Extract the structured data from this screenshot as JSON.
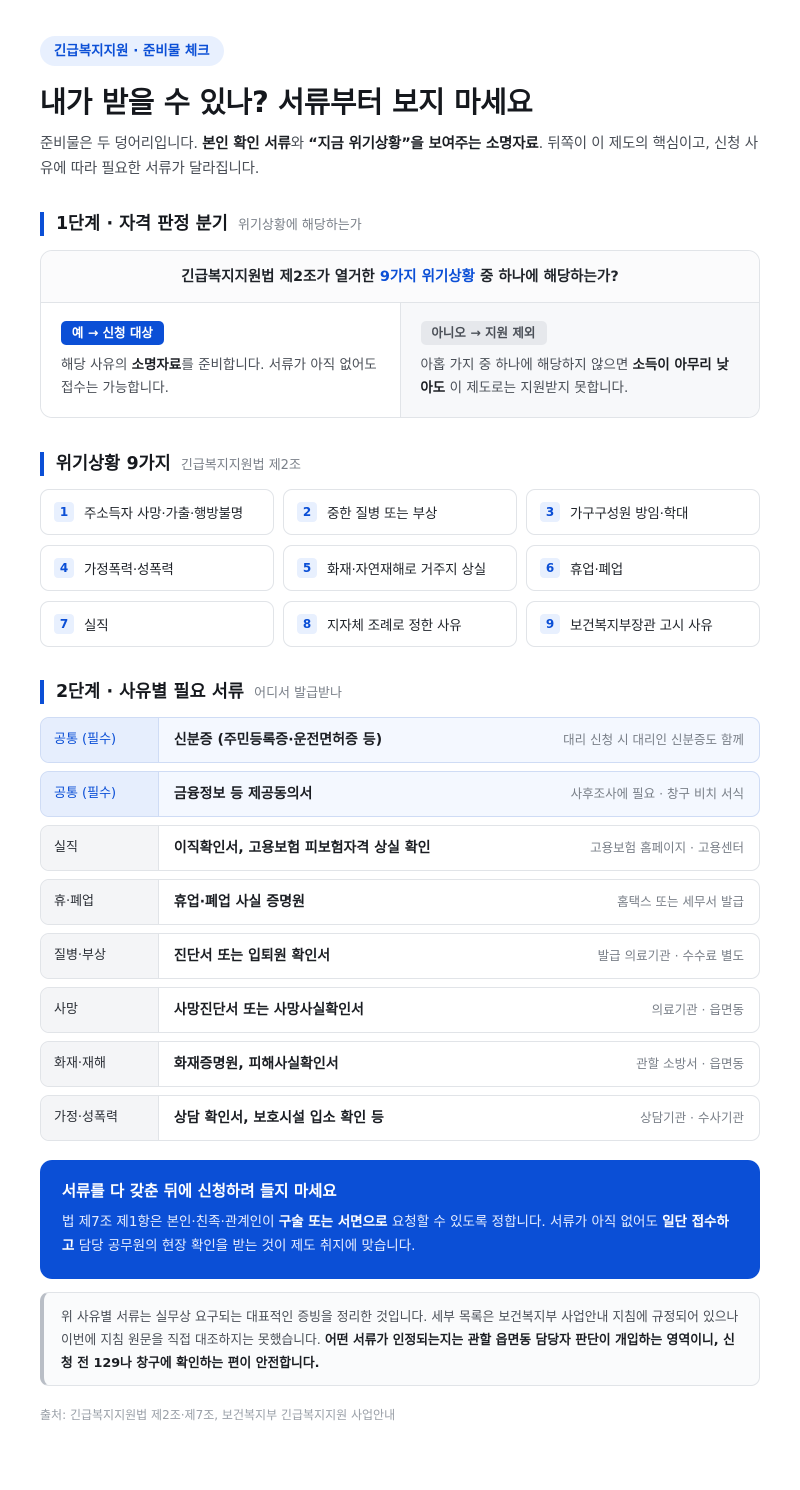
{
  "pill": "긴급복지지원 · 준비물 체크",
  "title": "내가 받을 수 있나? 서류부터 보지 마세요",
  "intro": {
    "p1": "준비물은 두 덩어리입니다. ",
    "b1": "본인 확인 서류",
    "p2": "와 ",
    "b2": "“지금 위기상황”을 보여주는 소명자료",
    "p3": ". 뒤쪽이 이 제도의 핵심이고, 신청 사유에 따라 필요한 서류가 달라집니다."
  },
  "step1": {
    "heading": "1단계 · 자격 판정 분기",
    "sub": "위기상황에 해당하는가",
    "question_pre": "긴급복지지원법 제2조가 열거한 ",
    "question_hl": "9가지 위기상황",
    "question_post": " 중 하나에 해당하는가?",
    "yes_badge": "예 → 신청 대상",
    "yes_p1": "해당 사유의 ",
    "yes_b": "소명자료",
    "yes_p2": "를 준비합니다. 서류가 아직 없어도 접수는 가능합니다.",
    "no_badge": "아니오 → 지원 제외",
    "no_p1": "아홉 가지 중 하나에 해당하지 않으면 ",
    "no_b": "소득이 아무리 낮아도",
    "no_p2": " 이 제도로는 지원받지 못합니다."
  },
  "situations": {
    "heading": "위기상황 9가지",
    "sub": "긴급복지지원법 제2조",
    "items": [
      {
        "n": "1",
        "label": "주소득자 사망·가출·행방불명"
      },
      {
        "n": "2",
        "label": "중한 질병 또는 부상"
      },
      {
        "n": "3",
        "label": "가구구성원 방임·학대"
      },
      {
        "n": "4",
        "label": "가정폭력·성폭력"
      },
      {
        "n": "5",
        "label": "화재·자연재해로 거주지 상실"
      },
      {
        "n": "6",
        "label": "휴업·폐업"
      },
      {
        "n": "7",
        "label": "실직"
      },
      {
        "n": "8",
        "label": "지자체 조례로 정한 사유"
      },
      {
        "n": "9",
        "label": "보건복지부장관 고시 사유"
      }
    ]
  },
  "step2": {
    "heading": "2단계 · 사유별 필요 서류",
    "sub": "어디서 발급받나",
    "rows": [
      {
        "cat": "공통 (필수)",
        "doc": "신분증 (주민등록증·운전면허증 등)",
        "src": "대리 신청 시 대리인 신분증도 함께",
        "req": true
      },
      {
        "cat": "공통 (필수)",
        "doc": "금융정보 등 제공동의서",
        "src": "사후조사에 필요 · 창구 비치 서식",
        "req": true
      },
      {
        "cat": "실직",
        "doc": "이직확인서, 고용보험 피보험자격 상실 확인",
        "src": "고용보험 홈페이지 · 고용센터",
        "req": false
      },
      {
        "cat": "휴·폐업",
        "doc": "휴업·폐업 사실 증명원",
        "src": "홈택스 또는 세무서 발급",
        "req": false
      },
      {
        "cat": "질병·부상",
        "doc": "진단서 또는 입퇴원 확인서",
        "src": "발급 의료기관 · 수수료 별도",
        "req": false
      },
      {
        "cat": "사망",
        "doc": "사망진단서 또는 사망사실확인서",
        "src": "의료기관 · 읍면동",
        "req": false
      },
      {
        "cat": "화재·재해",
        "doc": "화재증명원, 피해사실확인서",
        "src": "관할 소방서 · 읍면동",
        "req": false
      },
      {
        "cat": "가정·성폭력",
        "doc": "상담 확인서, 보호시설 입소 확인 등",
        "src": "상담기관 · 수사기관",
        "req": false
      }
    ]
  },
  "callout": {
    "title": "서류를 다 갖춘 뒤에 신청하려 들지 마세요",
    "p1": "법 제7조 제1항은 본인·친족·관계인이 ",
    "b1": "구술 또는 서면으로",
    "p2": " 요청할 수 있도록 정합니다. 서류가 아직 없어도 ",
    "b2": "일단 접수하고",
    "p3": " 담당 공무원의 현장 확인을 받는 것이 제도 취지에 맞습니다."
  },
  "note": {
    "p1": "위 사유별 서류는 실무상 요구되는 대표적인 증빙을 정리한 것입니다. 세부 목록은 보건복지부 사업안내 지침에 규정되어 있으나 이번에 지침 원문을 직접 대조하지는 못했습니다. ",
    "b1": "어떤 서류가 인정되는지는 관할 읍면동 담당자 판단이 개입하는 영역이니, 신청 전 129나 창구에 확인하는 편이 안전합니다."
  },
  "source": "출처: 긴급복지지원법 제2조·제7조, 보건복지부 긴급복지지원 사업안내",
  "colors": {
    "accent": "#0b4fd6",
    "accent_soft": "#e8f0fe"
  }
}
